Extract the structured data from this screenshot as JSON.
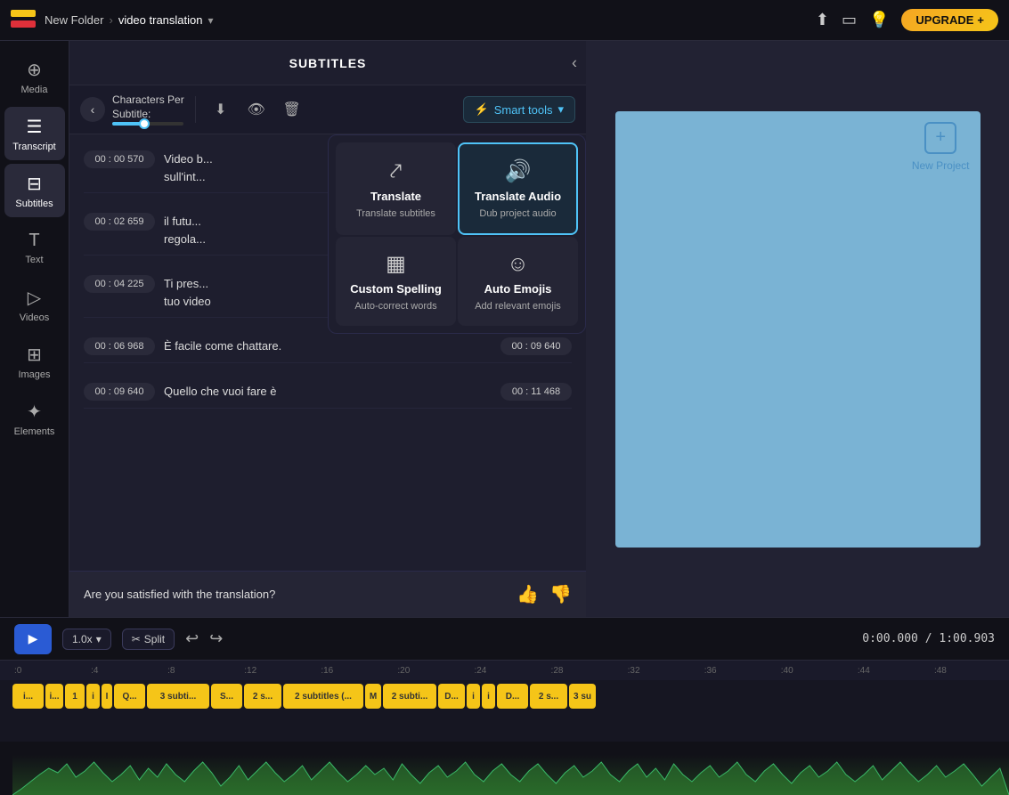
{
  "app": {
    "folder": "New Folder",
    "project": "video translation",
    "upgrade_label": "UPGRADE"
  },
  "topbar": {
    "icons": [
      "download-icon",
      "eye-icon",
      "sun-icon"
    ],
    "upgrade_plus": "+"
  },
  "sidebar": {
    "items": [
      {
        "id": "media",
        "label": "Media",
        "icon": "⊕"
      },
      {
        "id": "transcript",
        "label": "Transcript",
        "icon": "☰"
      },
      {
        "id": "subtitles",
        "label": "Subtitles",
        "icon": "▦",
        "active": true
      },
      {
        "id": "text",
        "label": "Text",
        "icon": "T"
      },
      {
        "id": "videos",
        "label": "Videos",
        "icon": "▷"
      },
      {
        "id": "images",
        "label": "Images",
        "icon": "⊞"
      },
      {
        "id": "elements",
        "label": "Elements",
        "icon": "✦"
      }
    ]
  },
  "panel": {
    "title": "SUBTITLES",
    "chars_label_line1": "Characters Per",
    "chars_label_line2": "Subtitle:"
  },
  "smart_tools": {
    "label": "Smart tools",
    "items": [
      {
        "id": "translate",
        "title": "Translate",
        "subtitle": "Translate subtitles",
        "icon": "⤤",
        "active": false
      },
      {
        "id": "translate-audio",
        "title": "Translate Audio",
        "subtitle": "Dub project audio",
        "icon": "♪",
        "active": true
      },
      {
        "id": "custom-spelling",
        "title": "Custom Spelling",
        "subtitle": "Auto-correct words",
        "icon": "▦",
        "active": false
      },
      {
        "id": "auto-emojis",
        "title": "Auto Emojis",
        "subtitle": "Add relevant emojis",
        "icon": "☺",
        "active": false
      }
    ]
  },
  "subtitles": [
    {
      "time_start": "00 : 00  570",
      "text": "Video b... sull'int...",
      "time_end": null
    },
    {
      "time_start": "00 : 02  659",
      "text": "il futu... regola...",
      "time_end": null
    },
    {
      "time_start": "00 : 04  225",
      "text": "Ti pres... tuo video",
      "time_end": null
    },
    {
      "time_start": "00 : 06  968",
      "text": "È facile come chattare.",
      "time_end": "00 : 09  640"
    },
    {
      "time_start": "00 : 09  640",
      "text": "Quello che vuoi fare è",
      "time_end": "00 : 11  468"
    }
  ],
  "feedback": {
    "question": "Are you satisfied with the translation?",
    "thumbs_up": "👍",
    "thumbs_down": "👎"
  },
  "playback": {
    "play_icon": "▶",
    "speed": "1.0x",
    "split_label": "Split",
    "undo_icon": "↩",
    "redo_icon": "↪",
    "time_current": "0:00.000",
    "time_total": "1:00.903"
  },
  "timeline": {
    "ruler_marks": [
      ":0",
      ":4",
      ":8",
      ":12",
      ":16",
      ":20",
      ":24",
      ":28",
      ":32",
      ":36",
      ":40",
      ":44",
      ":48"
    ],
    "clips_row1": [
      {
        "label": "i...",
        "width": 35
      },
      {
        "label": "i...",
        "width": 20
      },
      {
        "label": "1",
        "width": 22
      },
      {
        "label": "i",
        "width": 15
      },
      {
        "label": "I",
        "width": 12
      },
      {
        "label": "Q...",
        "width": 35
      },
      {
        "label": "3 subti...",
        "width": 70
      },
      {
        "label": "S...",
        "width": 35
      },
      {
        "label": "2 s...",
        "width": 42
      },
      {
        "label": "2 subtitles (..)",
        "width": 90
      },
      {
        "label": "M",
        "width": 18
      },
      {
        "label": "2 subti...",
        "width": 60
      },
      {
        "label": "D...",
        "width": 30
      },
      {
        "label": "i",
        "width": 15
      },
      {
        "label": "i",
        "width": 15
      },
      {
        "label": "D...",
        "width": 35
      },
      {
        "label": "2 s...",
        "width": 42
      },
      {
        "label": "3 su",
        "width": 30
      }
    ]
  },
  "preview": {
    "new_project_label": "New Project",
    "new_project_icon": "+"
  }
}
